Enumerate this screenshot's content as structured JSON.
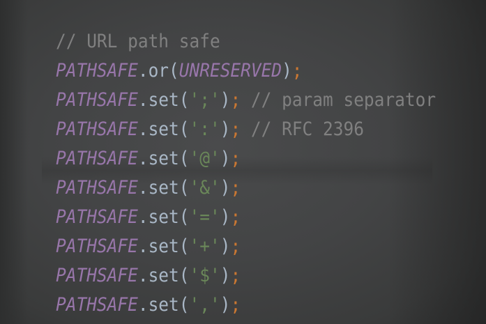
{
  "editor": {
    "colors": {
      "comment": "#808080",
      "field": "#9876aa",
      "plain": "#a9b7c6",
      "string": "#6a8759",
      "keyword": "#cc7832",
      "background": "#434445"
    },
    "lines": [
      [
        {
          "t": "comment",
          "v": "// URL path safe"
        }
      ],
      [
        {
          "t": "field",
          "v": "PATHSAFE"
        },
        {
          "t": "plain",
          "v": ".or("
        },
        {
          "t": "field",
          "v": "UNRESERVED"
        },
        {
          "t": "plain",
          "v": ")"
        },
        {
          "t": "semi",
          "v": ";"
        }
      ],
      [
        {
          "t": "field",
          "v": "PATHSAFE"
        },
        {
          "t": "plain",
          "v": ".set("
        },
        {
          "t": "string",
          "v": "';'"
        },
        {
          "t": "plain",
          "v": ")"
        },
        {
          "t": "semi",
          "v": ";"
        },
        {
          "t": "comment",
          "v": " // param separator"
        }
      ],
      [
        {
          "t": "field",
          "v": "PATHSAFE"
        },
        {
          "t": "plain",
          "v": ".set("
        },
        {
          "t": "string",
          "v": "':'"
        },
        {
          "t": "plain",
          "v": ")"
        },
        {
          "t": "semi",
          "v": ";"
        },
        {
          "t": "comment",
          "v": " // RFC 2396"
        }
      ],
      [
        {
          "t": "field",
          "v": "PATHSAFE"
        },
        {
          "t": "plain",
          "v": ".set("
        },
        {
          "t": "string",
          "v": "'@'"
        },
        {
          "t": "plain",
          "v": ")"
        },
        {
          "t": "semi",
          "v": ";"
        }
      ],
      [
        {
          "t": "field",
          "v": "PATHSAFE"
        },
        {
          "t": "plain",
          "v": ".set("
        },
        {
          "t": "string",
          "v": "'&'"
        },
        {
          "t": "plain",
          "v": ")"
        },
        {
          "t": "semi",
          "v": ";"
        }
      ],
      [
        {
          "t": "field",
          "v": "PATHSAFE"
        },
        {
          "t": "plain",
          "v": ".set("
        },
        {
          "t": "string",
          "v": "'='"
        },
        {
          "t": "plain",
          "v": ")"
        },
        {
          "t": "semi",
          "v": ";"
        }
      ],
      [
        {
          "t": "field",
          "v": "PATHSAFE"
        },
        {
          "t": "plain",
          "v": ".set("
        },
        {
          "t": "string",
          "v": "'+'"
        },
        {
          "t": "plain",
          "v": ")"
        },
        {
          "t": "semi",
          "v": ";"
        }
      ],
      [
        {
          "t": "field",
          "v": "PATHSAFE"
        },
        {
          "t": "plain",
          "v": ".set("
        },
        {
          "t": "string",
          "v": "'$'"
        },
        {
          "t": "plain",
          "v": ")"
        },
        {
          "t": "semi",
          "v": ";"
        }
      ],
      [
        {
          "t": "field",
          "v": "PATHSAFE"
        },
        {
          "t": "plain",
          "v": ".set("
        },
        {
          "t": "string",
          "v": "','"
        },
        {
          "t": "plain",
          "v": ")"
        },
        {
          "t": "semi",
          "v": ";"
        }
      ]
    ]
  }
}
